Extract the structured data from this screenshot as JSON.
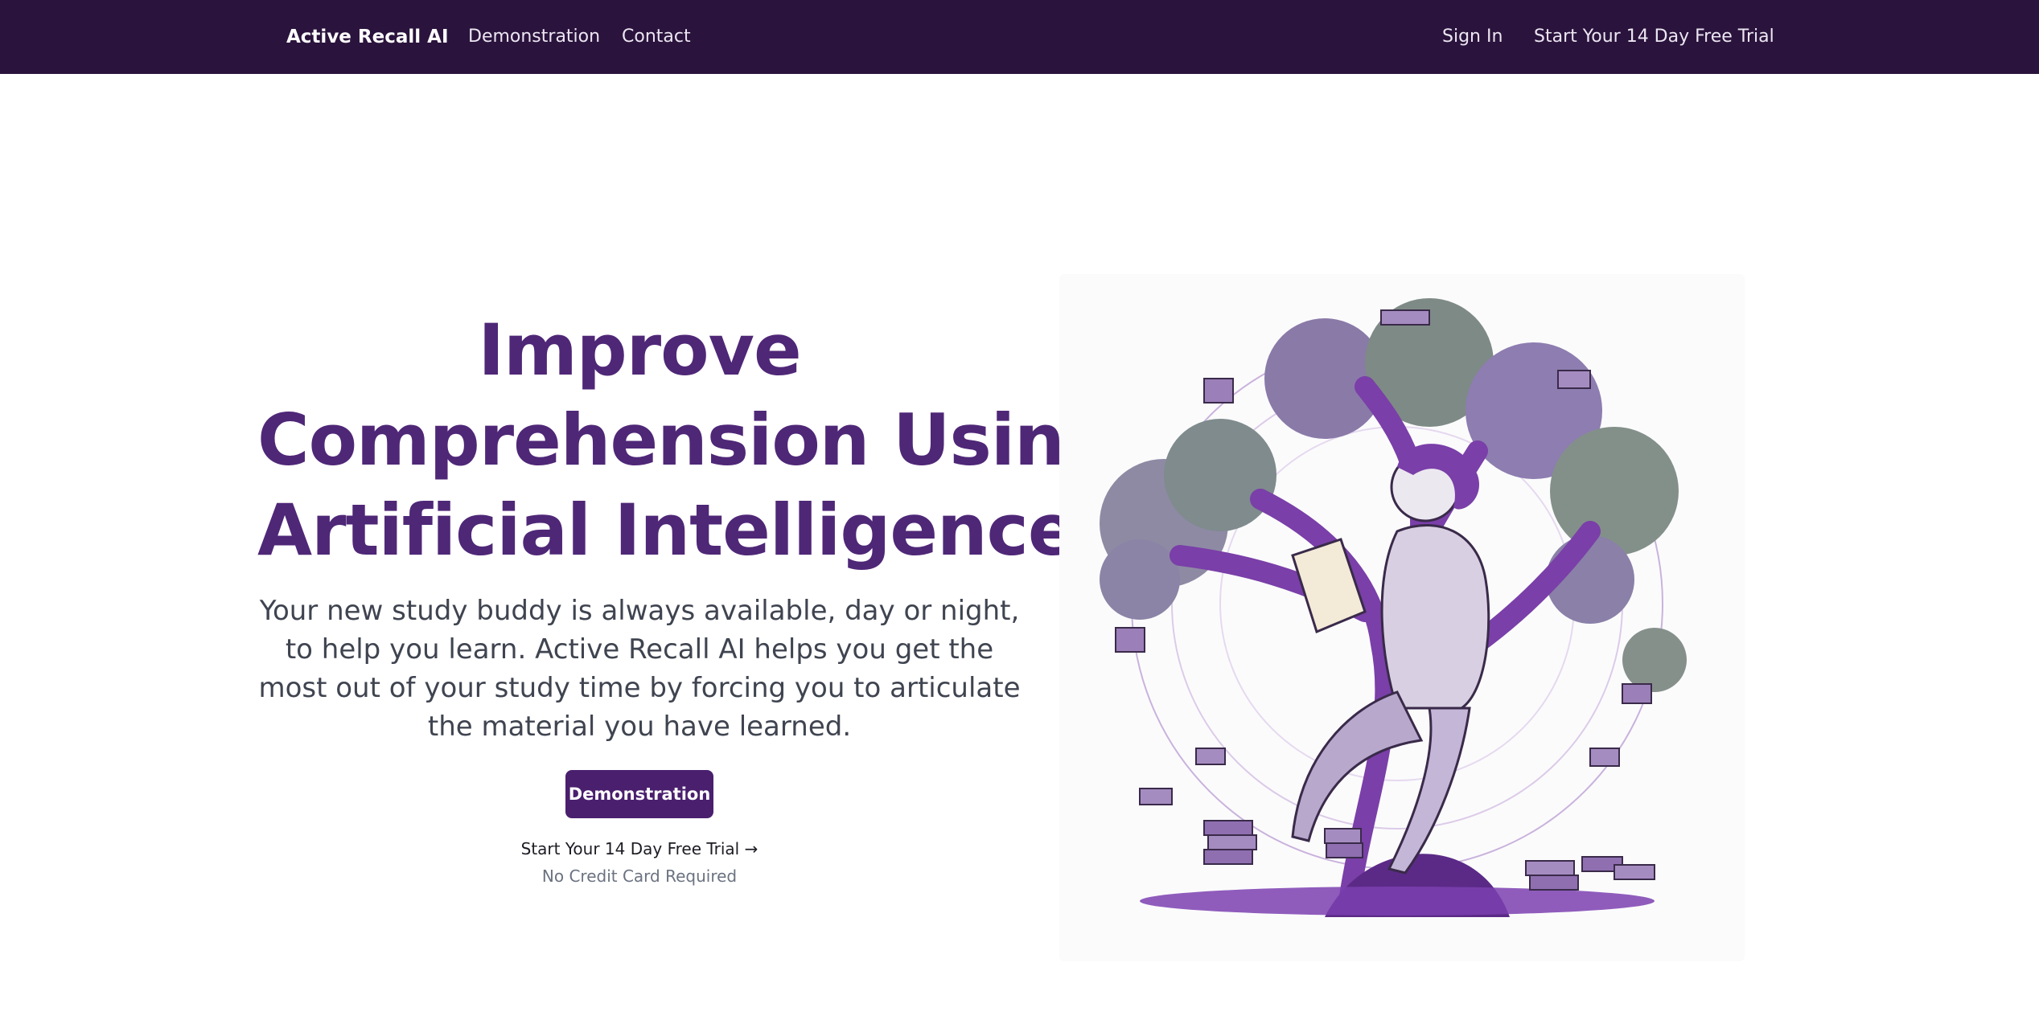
{
  "nav": {
    "brand": "Active Recall AI",
    "links": [
      "Demonstration",
      "Contact"
    ],
    "sign_in": "Sign In",
    "trial": "Start Your 14 Day Free Trial"
  },
  "hero": {
    "title_lines": [
      "Improve",
      "Comprehension Using",
      "Artificial Intelligence"
    ],
    "subtitle": "Your new study buddy is always available, day or night, to help you learn. Active Recall AI helps you get the most out of your study time by forcing you to articulate the material you have learned.",
    "demo_button": "Demonstration",
    "trial_link": "Start Your 14 Day Free Trial →",
    "no_cc": "No Credit Card Required"
  },
  "colors": {
    "nav_bg": "#2a133c",
    "title": "#4f2777",
    "button_bg": "#4a1f6e",
    "illustration_purple": "#7a3fa8"
  },
  "illustration": {
    "name": "woman-reading-under-tree-illustration"
  }
}
